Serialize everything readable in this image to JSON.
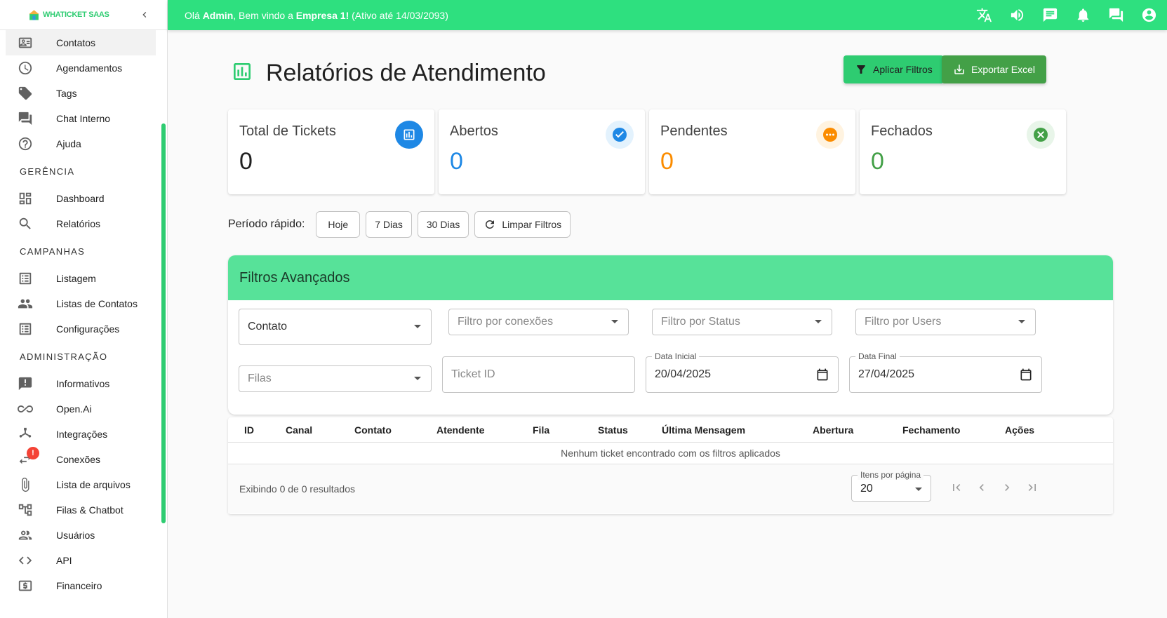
{
  "app": {
    "logo_text": "WHATICKET SAAS"
  },
  "topbar": {
    "greeting_prefix": "Olá ",
    "user": "Admin",
    "greeting_middle": ", Bem vindo a ",
    "company": "Empresa 1!",
    "status": " (Ativo até 14/03/2093)",
    "icons": [
      "translate-icon",
      "volume-icon",
      "chat-icon",
      "bell-icon",
      "forum-icon",
      "account-icon"
    ]
  },
  "sidebar": {
    "items_top": [
      {
        "label": "Contatos",
        "icon": "contacts-icon"
      },
      {
        "label": "Agendamentos",
        "icon": "schedule-icon"
      },
      {
        "label": "Tags",
        "icon": "tag-icon"
      },
      {
        "label": "Chat Interno",
        "icon": "internal-chat-icon"
      },
      {
        "label": "Ajuda",
        "icon": "help-icon"
      }
    ],
    "section_management": "GERÊNCIA",
    "items_management": [
      {
        "label": "Dashboard",
        "icon": "dashboard-icon"
      },
      {
        "label": "Relatórios",
        "icon": "search-icon"
      }
    ],
    "section_campaigns": "CAMPANHAS",
    "items_campaigns": [
      {
        "label": "Listagem",
        "icon": "list-icon"
      },
      {
        "label": "Listas de Contatos",
        "icon": "people-icon"
      },
      {
        "label": "Configurações",
        "icon": "list-icon"
      }
    ],
    "section_admin": "ADMINISTRAÇÃO",
    "items_admin": [
      {
        "label": "Informativos",
        "icon": "announcement-icon"
      },
      {
        "label": "Open.Ai",
        "icon": "infinity-icon"
      },
      {
        "label": "Integrações",
        "icon": "hub-icon"
      },
      {
        "label": "Conexões",
        "icon": "sync-icon",
        "badge": "!"
      },
      {
        "label": "Lista de arquivos",
        "icon": "attach-icon"
      },
      {
        "label": "Filas & Chatbot",
        "icon": "tree-icon"
      },
      {
        "label": "Usuários",
        "icon": "users-icon"
      },
      {
        "label": "API",
        "icon": "code-icon"
      },
      {
        "label": "Financeiro",
        "icon": "money-icon"
      }
    ]
  },
  "page": {
    "title": "Relatórios de Atendimento",
    "apply_filters": "Aplicar Filtros",
    "export_excel": "Exportar Excel",
    "colors": {
      "green_button": "#2ecc71",
      "export_button": "#43a047"
    }
  },
  "cards": [
    {
      "label": "Total de Tickets",
      "value": "0",
      "color": "#212121",
      "icon": "chart-icon",
      "icon_bg": "#1e88e5"
    },
    {
      "label": "Abertos",
      "value": "0",
      "color": "#1e88e5",
      "icon": "check-circle-icon",
      "icon_bg": "#e3f2fd"
    },
    {
      "label": "Pendentes",
      "value": "0",
      "color": "#fb8c00",
      "icon": "pending-icon",
      "icon_bg": "#fff3e0"
    },
    {
      "label": "Fechados",
      "value": "0",
      "color": "#43a047",
      "icon": "cancel-icon",
      "icon_bg": "#e8f5e9"
    }
  ],
  "quick": {
    "label": "Período rápido:",
    "today": "Hoje",
    "seven": "7 Dias",
    "thirty": "30 Dias",
    "clear": "Limpar Filtros"
  },
  "filters": {
    "title": "Filtros Avançados",
    "contato": "Contato",
    "conexoes": "Filtro por conexões",
    "status": "Filtro por Status",
    "users": "Filtro por Users",
    "filas": "Filas",
    "ticket_id": "Ticket ID",
    "data_inicial_label": "Data Inicial",
    "data_inicial": "20/04/2025",
    "data_final_label": "Data Final",
    "data_final": "27/04/2025"
  },
  "table": {
    "columns": [
      "ID",
      "Canal",
      "Contato",
      "Atendente",
      "Fila",
      "Status",
      "Última Mensagem",
      "Abertura",
      "Fechamento",
      "Ações"
    ],
    "empty": "Nenhum ticket encontrado com os filtros aplicados",
    "showing": "Exibindo 0 de 0 resultados",
    "per_page_label": "Itens por página",
    "per_page": "20"
  }
}
